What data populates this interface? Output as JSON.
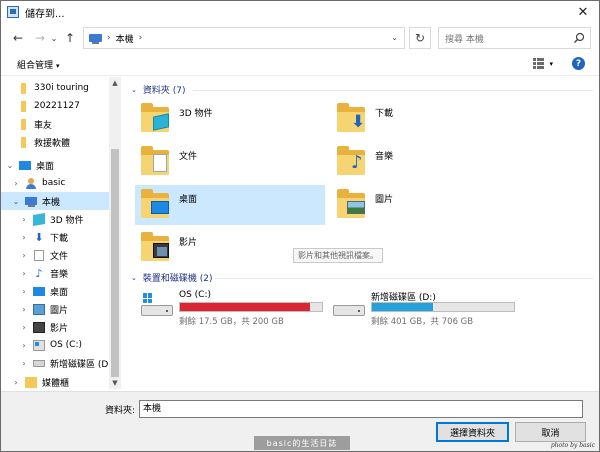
{
  "window": {
    "title": "儲存到..."
  },
  "nav": {
    "back_glyph": "←",
    "forward_glyph": "→",
    "recent_glyph": "⌄",
    "up_glyph": "↑",
    "address_parts": [
      "›",
      "本機",
      "›"
    ],
    "address_dropdown": "⌄",
    "refresh_glyph": "↻",
    "search_placeholder": "搜尋 本機"
  },
  "toolbar": {
    "organize_label": "組合管理",
    "caret": "▾",
    "view_caret": "▾",
    "help": "?"
  },
  "tree": {
    "items": [
      {
        "label": "330i touring",
        "icon": "folder",
        "expander": ""
      },
      {
        "label": "20221127",
        "icon": "folder",
        "expander": ""
      },
      {
        "label": "車友",
        "icon": "folder",
        "expander": ""
      },
      {
        "label": "救援軟體",
        "icon": "folder",
        "expander": ""
      },
      {
        "label": "桌面",
        "icon": "desktop-icon",
        "expander": "⌄"
      },
      {
        "label": "basic",
        "icon": "user-icon",
        "expander": "›"
      },
      {
        "label": "本機",
        "icon": "pc-icon",
        "expander": "⌄"
      },
      {
        "label": "3D 物件",
        "icon": "cube-icon",
        "expander": "›"
      },
      {
        "label": "下載",
        "icon": "download-icon",
        "expander": "›"
      },
      {
        "label": "文件",
        "icon": "document-icon",
        "expander": "›"
      },
      {
        "label": "音樂",
        "icon": "music-icon",
        "expander": "›"
      },
      {
        "label": "桌面",
        "icon": "desktop-icon",
        "expander": "›"
      },
      {
        "label": "圖片",
        "icon": "pictures-icon",
        "expander": "›"
      },
      {
        "label": "影片",
        "icon": "video-icon",
        "expander": "›"
      },
      {
        "label": "OS (C:)",
        "icon": "os-drive-icon",
        "expander": "›"
      },
      {
        "label": "新增磁碟區 (D:",
        "icon": "drive-icon",
        "expander": "›"
      },
      {
        "label": "媒體櫃",
        "icon": "library-icon",
        "expander": "›"
      }
    ],
    "scroll_up": "▲",
    "scroll_down": "▼"
  },
  "content": {
    "folders_header": "資料夾 (7)",
    "drives_header": "裝置和磁碟機 (2)",
    "chevron": "⌄",
    "folders": [
      {
        "label": "3D 物件",
        "icon": "3d-objects-folder-icon"
      },
      {
        "label": "下載",
        "icon": "downloads-folder-icon"
      },
      {
        "label": "文件",
        "icon": "documents-folder-icon"
      },
      {
        "label": "音樂",
        "icon": "music-folder-icon"
      },
      {
        "label": "桌面",
        "icon": "desktop-folder-icon"
      },
      {
        "label": "圖片",
        "icon": "pictures-folder-icon"
      },
      {
        "label": "影片",
        "icon": "videos-folder-icon"
      }
    ],
    "tooltip": "影片和其他視訊檔案。",
    "drives": [
      {
        "name": "OS (C:)",
        "space": "剩餘 17.5 GB，共 200 GB",
        "used_fraction": 0.9125,
        "bar_color": "#da2632"
      },
      {
        "name": "新增磁碟區 (D:)",
        "space": "剩餘 401 GB，共 706 GB",
        "used_fraction": 0.432,
        "bar_color": "#26a0da"
      }
    ]
  },
  "bottom": {
    "folder_label": "資料夾:",
    "folder_value": "本機",
    "select_label": "選擇資料夾",
    "cancel_label": "取消"
  },
  "watermarks": {
    "center": "basic的生活日誌",
    "corner": "photo by basic"
  }
}
